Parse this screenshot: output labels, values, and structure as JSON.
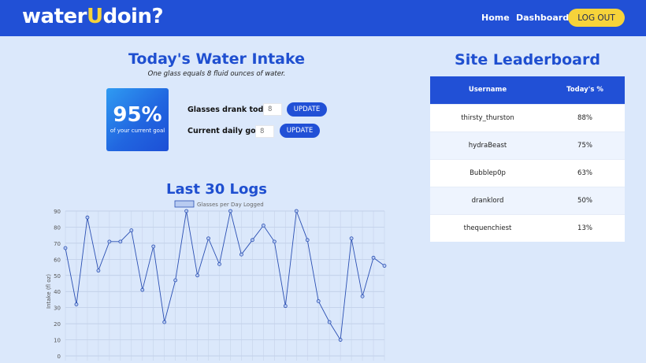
{
  "header": {
    "logo_prefix": "water",
    "logo_accent": "U",
    "logo_suffix": "doin?",
    "nav": {
      "home": "Home",
      "dashboard": "Dashboard"
    },
    "logout": "LOG OUT"
  },
  "intake": {
    "title": "Today's Water Intake",
    "subtitle": "One glass equals 8 fluid ounces of water.",
    "percent": "95%",
    "percent_label": "of your current goal",
    "glasses_label": "Glasses drank today:",
    "glasses_placeholder": "8",
    "goal_label": "Current daily goal:",
    "goal_placeholder": "8",
    "update_label": "UPDATE"
  },
  "logs": {
    "title": "Last 30 Logs"
  },
  "leaderboard": {
    "title": "Site Leaderboard",
    "headers": [
      "Username",
      "Today's %"
    ],
    "rows": [
      {
        "username": "thirsty_thurston",
        "pct": "88%"
      },
      {
        "username": "hydraBeast",
        "pct": "75%"
      },
      {
        "username": "Bubblep0p",
        "pct": "63%"
      },
      {
        "username": "dranklord",
        "pct": "50%"
      },
      {
        "username": "thequenchiest",
        "pct": "13%"
      }
    ]
  },
  "colors": {
    "brand": "#2150d6",
    "accent": "#f6d33a",
    "background": "#dbe8fb",
    "line": "#2a4fb3"
  },
  "chart_data": {
    "type": "line",
    "legend": "Glasses per Day Logged",
    "ylabel": "Intake (fl oz)",
    "ylim": [
      0,
      90
    ],
    "yticks": [
      0,
      10,
      20,
      30,
      40,
      50,
      60,
      70,
      80,
      90
    ],
    "grid": true,
    "legend_position": "top-center",
    "values": [
      67,
      32,
      86,
      53,
      71,
      71,
      78,
      41,
      68,
      21,
      47,
      90,
      50,
      73,
      57,
      90,
      63,
      72,
      81,
      71,
      31,
      90,
      72,
      34,
      21,
      10,
      73,
      37,
      61,
      56
    ]
  }
}
